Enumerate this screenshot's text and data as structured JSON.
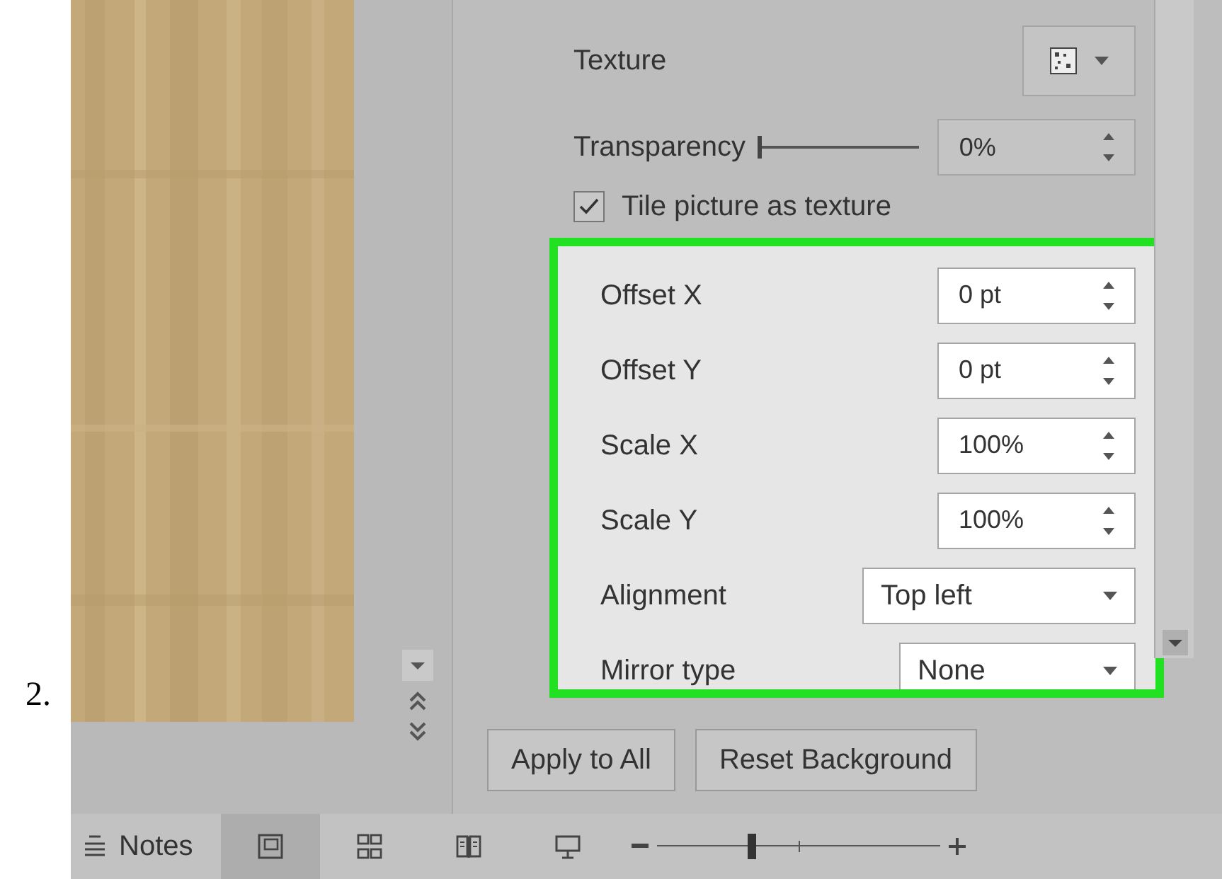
{
  "step": "2.",
  "texture": {
    "label": "Texture"
  },
  "transparency": {
    "label": "Transparency",
    "level": 0,
    "value": "0%"
  },
  "tile": {
    "label": "Tile picture as texture",
    "checked": true
  },
  "fields": [
    {
      "kind": "spin",
      "label": "Offset X",
      "value": "0 pt"
    },
    {
      "kind": "spin",
      "label": "Offset Y",
      "value": "0 pt"
    },
    {
      "kind": "spin",
      "label": "Scale X",
      "value": "100%"
    },
    {
      "kind": "spin",
      "label": "Scale Y",
      "value": "100%"
    },
    {
      "kind": "dropdown",
      "label": "Alignment",
      "value": "Top left"
    },
    {
      "kind": "dropdown",
      "label": "Mirror type",
      "value": "None"
    }
  ],
  "buttons": [
    {
      "label": "Apply to All"
    },
    {
      "label": "Reset Background"
    }
  ],
  "status_bar": {
    "notes": "Notes",
    "views": [
      {
        "kind": "normal",
        "selected": true
      },
      {
        "kind": "sorter",
        "selected": false
      },
      {
        "kind": "reading",
        "selected": false
      },
      {
        "kind": "slideshow",
        "selected": false
      }
    ],
    "zoom": {
      "level": 0.33
    }
  }
}
